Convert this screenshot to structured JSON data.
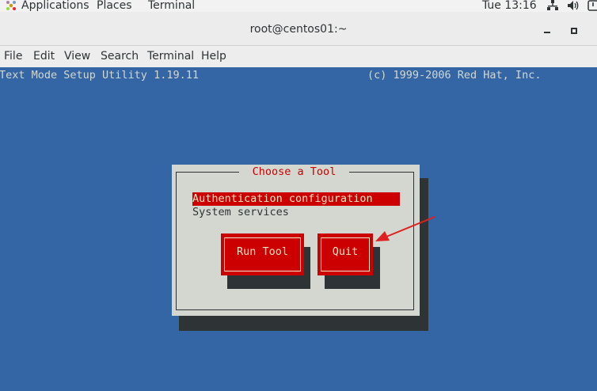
{
  "topbar": {
    "applications": "Applications",
    "places": "Places",
    "terminal": "Terminal",
    "clock": "Tue 13:16",
    "icons": [
      "app-menu-icon",
      "network-icon",
      "volume-icon",
      "power-icon"
    ]
  },
  "window": {
    "title": "root@centos01:~"
  },
  "menubar": {
    "items": [
      "File",
      "Edit",
      "View",
      "Search",
      "Terminal",
      "Help"
    ]
  },
  "terminal": {
    "header_left": "Text Mode Setup Utility 1.19.11",
    "header_right": "(c) 1999-2006 Red Hat, Inc."
  },
  "dialog": {
    "title": "Choose a Tool",
    "items": [
      "Authentication configuration",
      "System services"
    ],
    "selected_index": 0,
    "buttons": [
      "Run Tool",
      "Quit"
    ]
  },
  "colors": {
    "terminal_bg": "#3465a4",
    "dialog_bg": "#d3d7cf",
    "accent_red": "#cc0000",
    "annotation_arrow": "#e02020"
  }
}
